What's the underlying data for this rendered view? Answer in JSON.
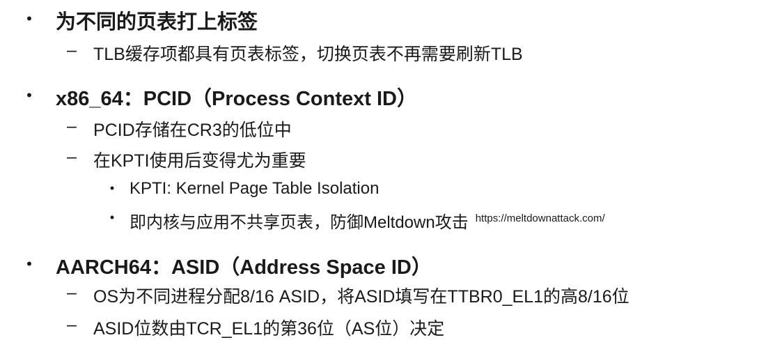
{
  "items": [
    {
      "level": 1,
      "bullet": "•",
      "text": "为不同的页表打上标签"
    },
    {
      "level": 2,
      "bullet": "–",
      "text": "TLB缓存项都具有页表标签，切换页表不再需要刷新TLB"
    },
    {
      "level": 1,
      "bullet": "•",
      "text": "x86_64：PCID（Process Context ID）"
    },
    {
      "level": 2,
      "bullet": "–",
      "text": "PCID存储在CR3的低位中"
    },
    {
      "level": 2,
      "bullet": "–",
      "text": "在KPTI使用后变得尤为重要"
    },
    {
      "level": 3,
      "bullet": "•",
      "text": "KPTI: Kernel Page Table Isolation"
    },
    {
      "level": 3,
      "bullet": "•",
      "text": "即内核与应用不共享页表，防御Meltdown攻击",
      "ref": "https://meltdownattack.com/"
    },
    {
      "level": 1,
      "bullet": "•",
      "text": "AARCH64：ASID（Address Space ID）"
    },
    {
      "level": 2,
      "bullet": "–",
      "text": "OS为不同进程分配8/16 ASID，将ASID填写在TTBR0_EL1的高8/16位"
    },
    {
      "level": 2,
      "bullet": "–",
      "text": "ASID位数由TCR_EL1的第36位（AS位）决定"
    }
  ]
}
